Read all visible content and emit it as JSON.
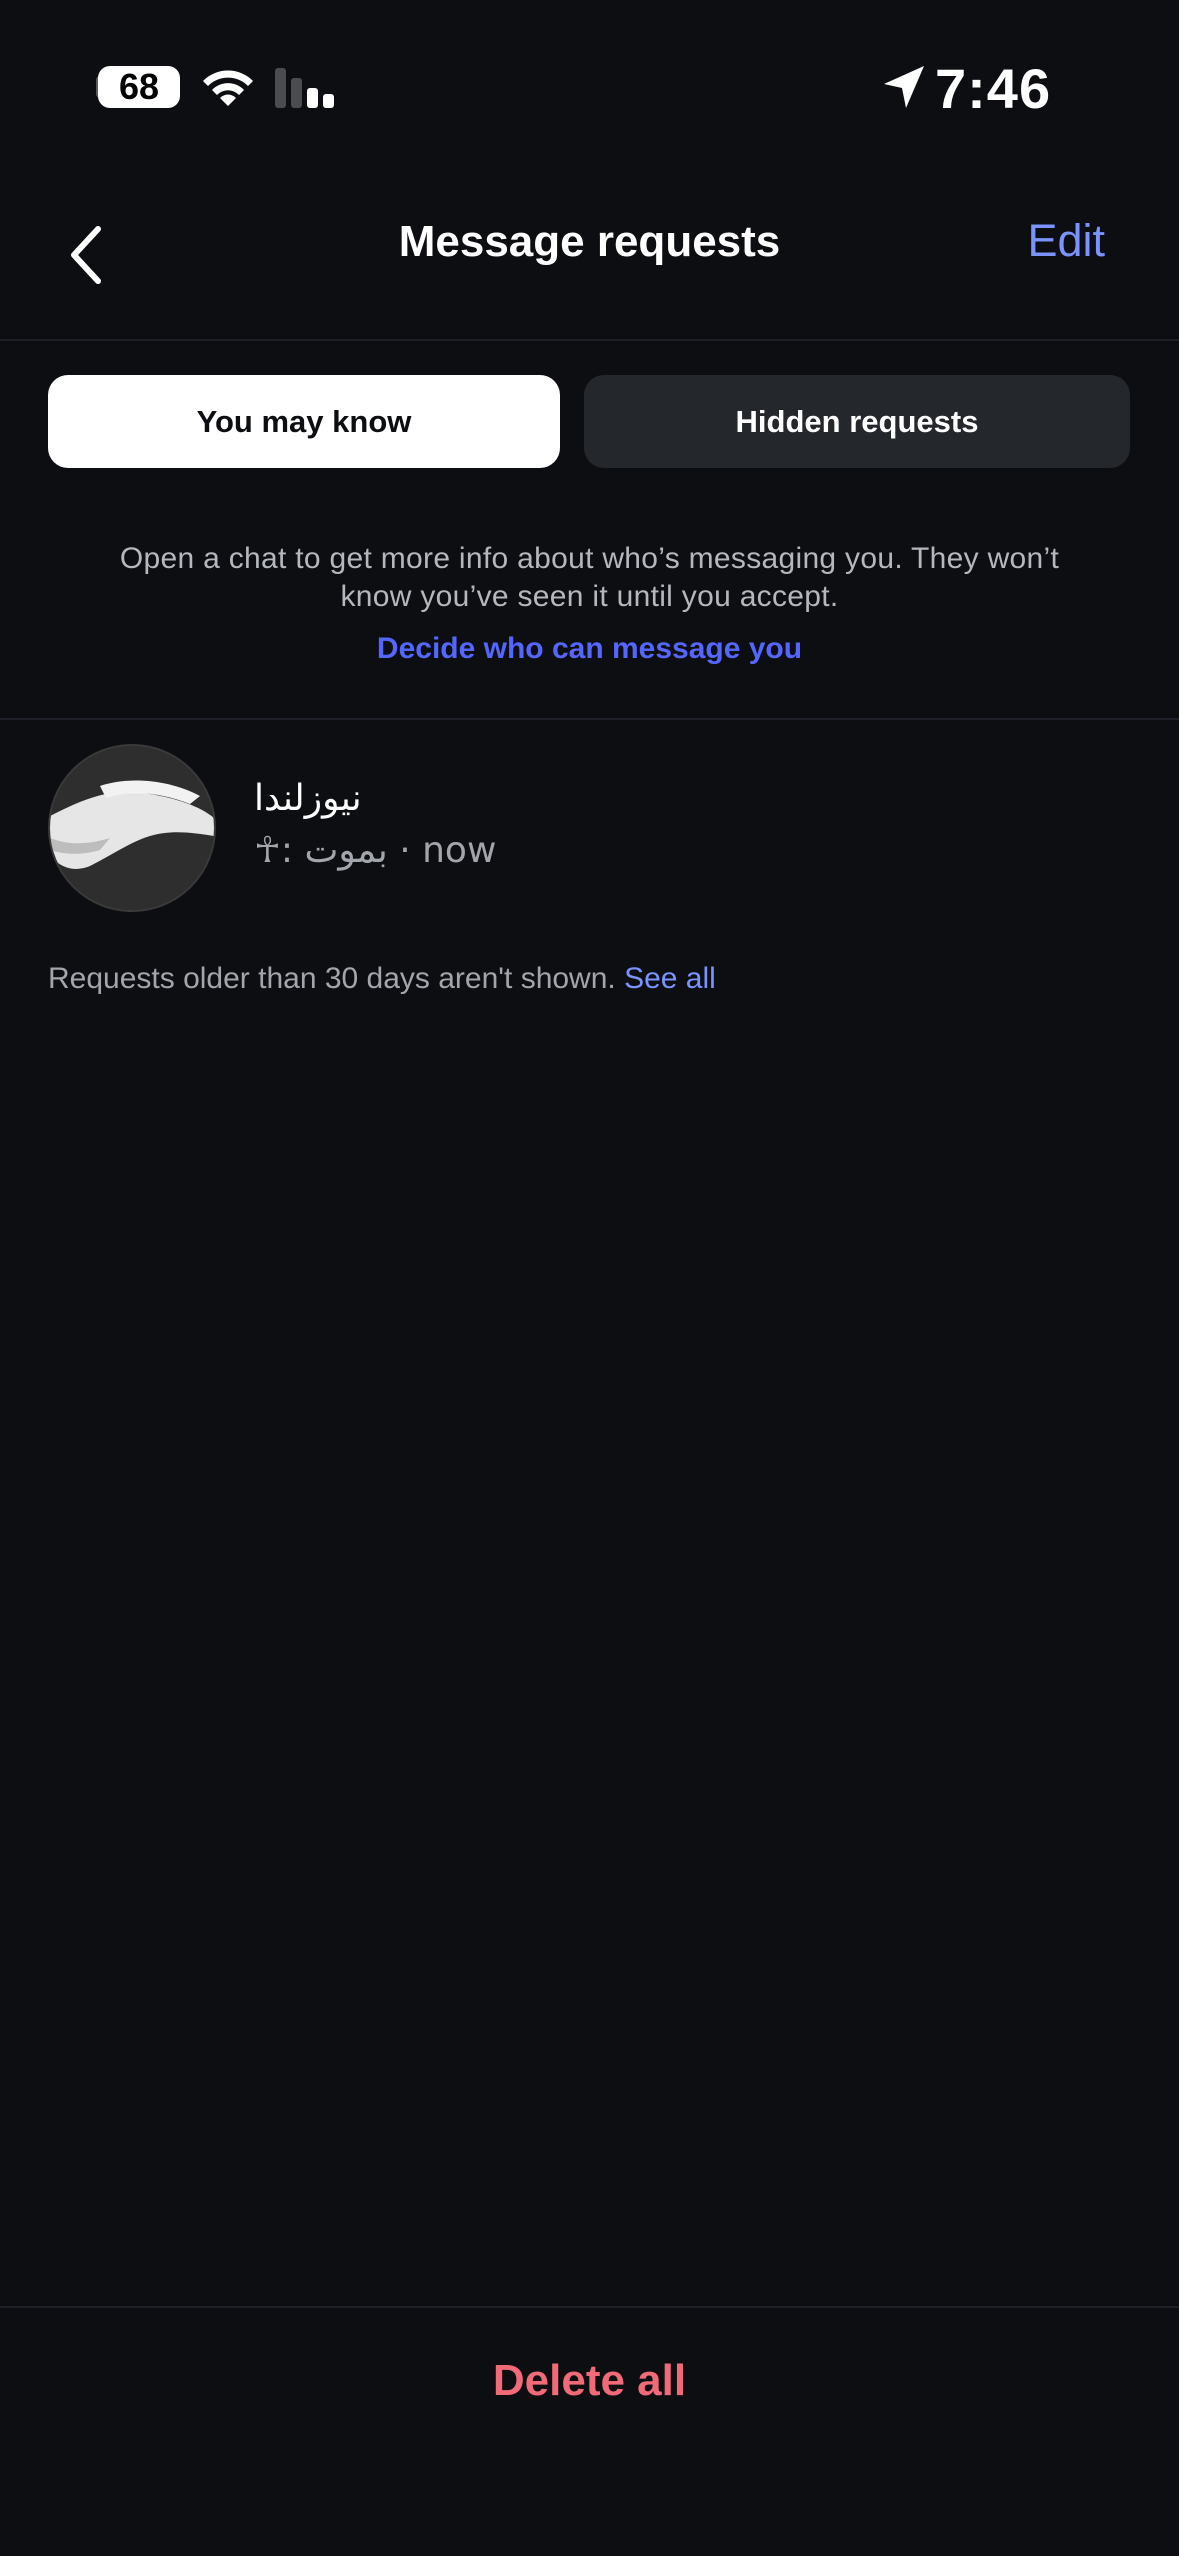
{
  "status_bar": {
    "battery": "68",
    "time": "7:46"
  },
  "header": {
    "title": "Message requests",
    "edit_label": "Edit"
  },
  "tabs": [
    {
      "label": "You may know",
      "active": true
    },
    {
      "label": "Hidden requests",
      "active": false
    }
  ],
  "info": {
    "text": "Open a chat to get more info about who’s messaging you. They won’t know you’ve seen it until you accept.",
    "link": "Decide who can message you"
  },
  "requests": [
    {
      "name": "نیوزلندا",
      "preview": "☥: بموت · now"
    }
  ],
  "footer_note": {
    "text": "Requests older than 30 days aren't shown.",
    "link": "See all"
  },
  "bottom": {
    "delete_all_label": "Delete all"
  },
  "colors": {
    "background": "#0c0e12",
    "accent": "#7c92ff",
    "link": "#5566ff",
    "danger": "#f06a78"
  }
}
